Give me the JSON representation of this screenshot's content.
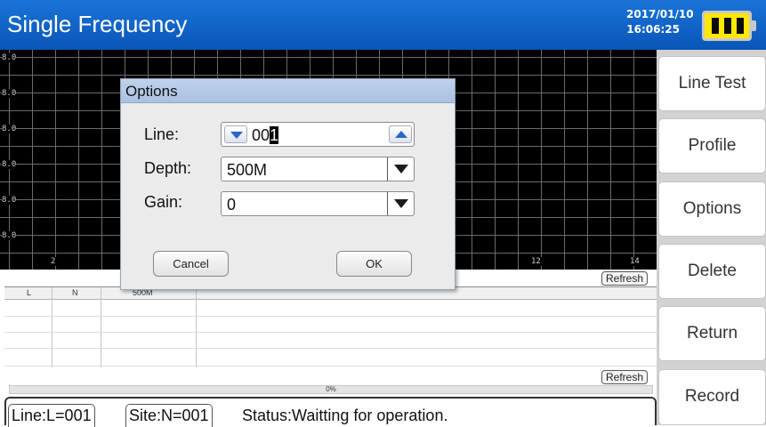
{
  "header": {
    "title": "Single Frequency",
    "date": "2017/01/10",
    "time": "16:06:25",
    "battery_level": 1.0
  },
  "plot": {
    "y_ticks": [
      "8.0",
      "8.0",
      "8.0",
      "8.0",
      "8.0",
      "8.0"
    ],
    "x_ticks": [
      "2",
      "12",
      "14"
    ],
    "refresh_label": "Refresh"
  },
  "table": {
    "columns": [
      "L",
      "N",
      "500M"
    ],
    "rows": []
  },
  "progress": {
    "label": "0%",
    "value": 0,
    "refresh_label": "Refresh"
  },
  "status": {
    "line": "Line:L=001",
    "site": "Site:N=001",
    "message": "Status:Waitting for operation."
  },
  "sidebar": {
    "items": [
      {
        "label": "Line Test"
      },
      {
        "label": "Profile"
      },
      {
        "label": "Options"
      },
      {
        "label": "Delete"
      },
      {
        "label": "Return"
      },
      {
        "label": "Record"
      }
    ]
  },
  "dialog": {
    "title": "Options",
    "line_label": "Line:",
    "line_value_prefix": "00",
    "line_value_cursor": "1",
    "depth_label": "Depth:",
    "depth_value": "500M",
    "gain_label": "Gain:",
    "gain_value": "0",
    "cancel_label": "Cancel",
    "ok_label": "OK"
  },
  "colors": {
    "titlebar": "#0a55b8",
    "battery": "#ffe800",
    "plot_background": "#000000",
    "sidebar_background": "#d2d2d2"
  }
}
